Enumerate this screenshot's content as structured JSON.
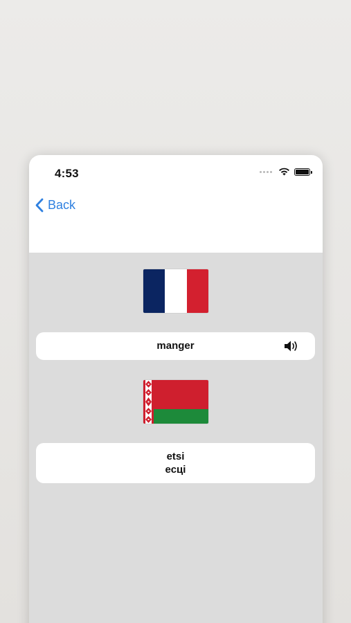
{
  "status_bar": {
    "time": "4:53"
  },
  "nav": {
    "back_label": "Back"
  },
  "source": {
    "flag": "flag-france",
    "word": "manger"
  },
  "target": {
    "flag": "flag-belarus",
    "translit": "etsi",
    "word": "есці"
  },
  "colors": {
    "accent": "#2f80e0",
    "fr_blue": "#0b2561",
    "fr_red": "#d3202f",
    "by_red": "#cf1f2e",
    "by_green": "#1d8a3a"
  },
  "icons": [
    "back-chevron-icon",
    "speaker-icon",
    "wifi-icon",
    "battery-icon",
    "signal-dots-icon"
  ]
}
